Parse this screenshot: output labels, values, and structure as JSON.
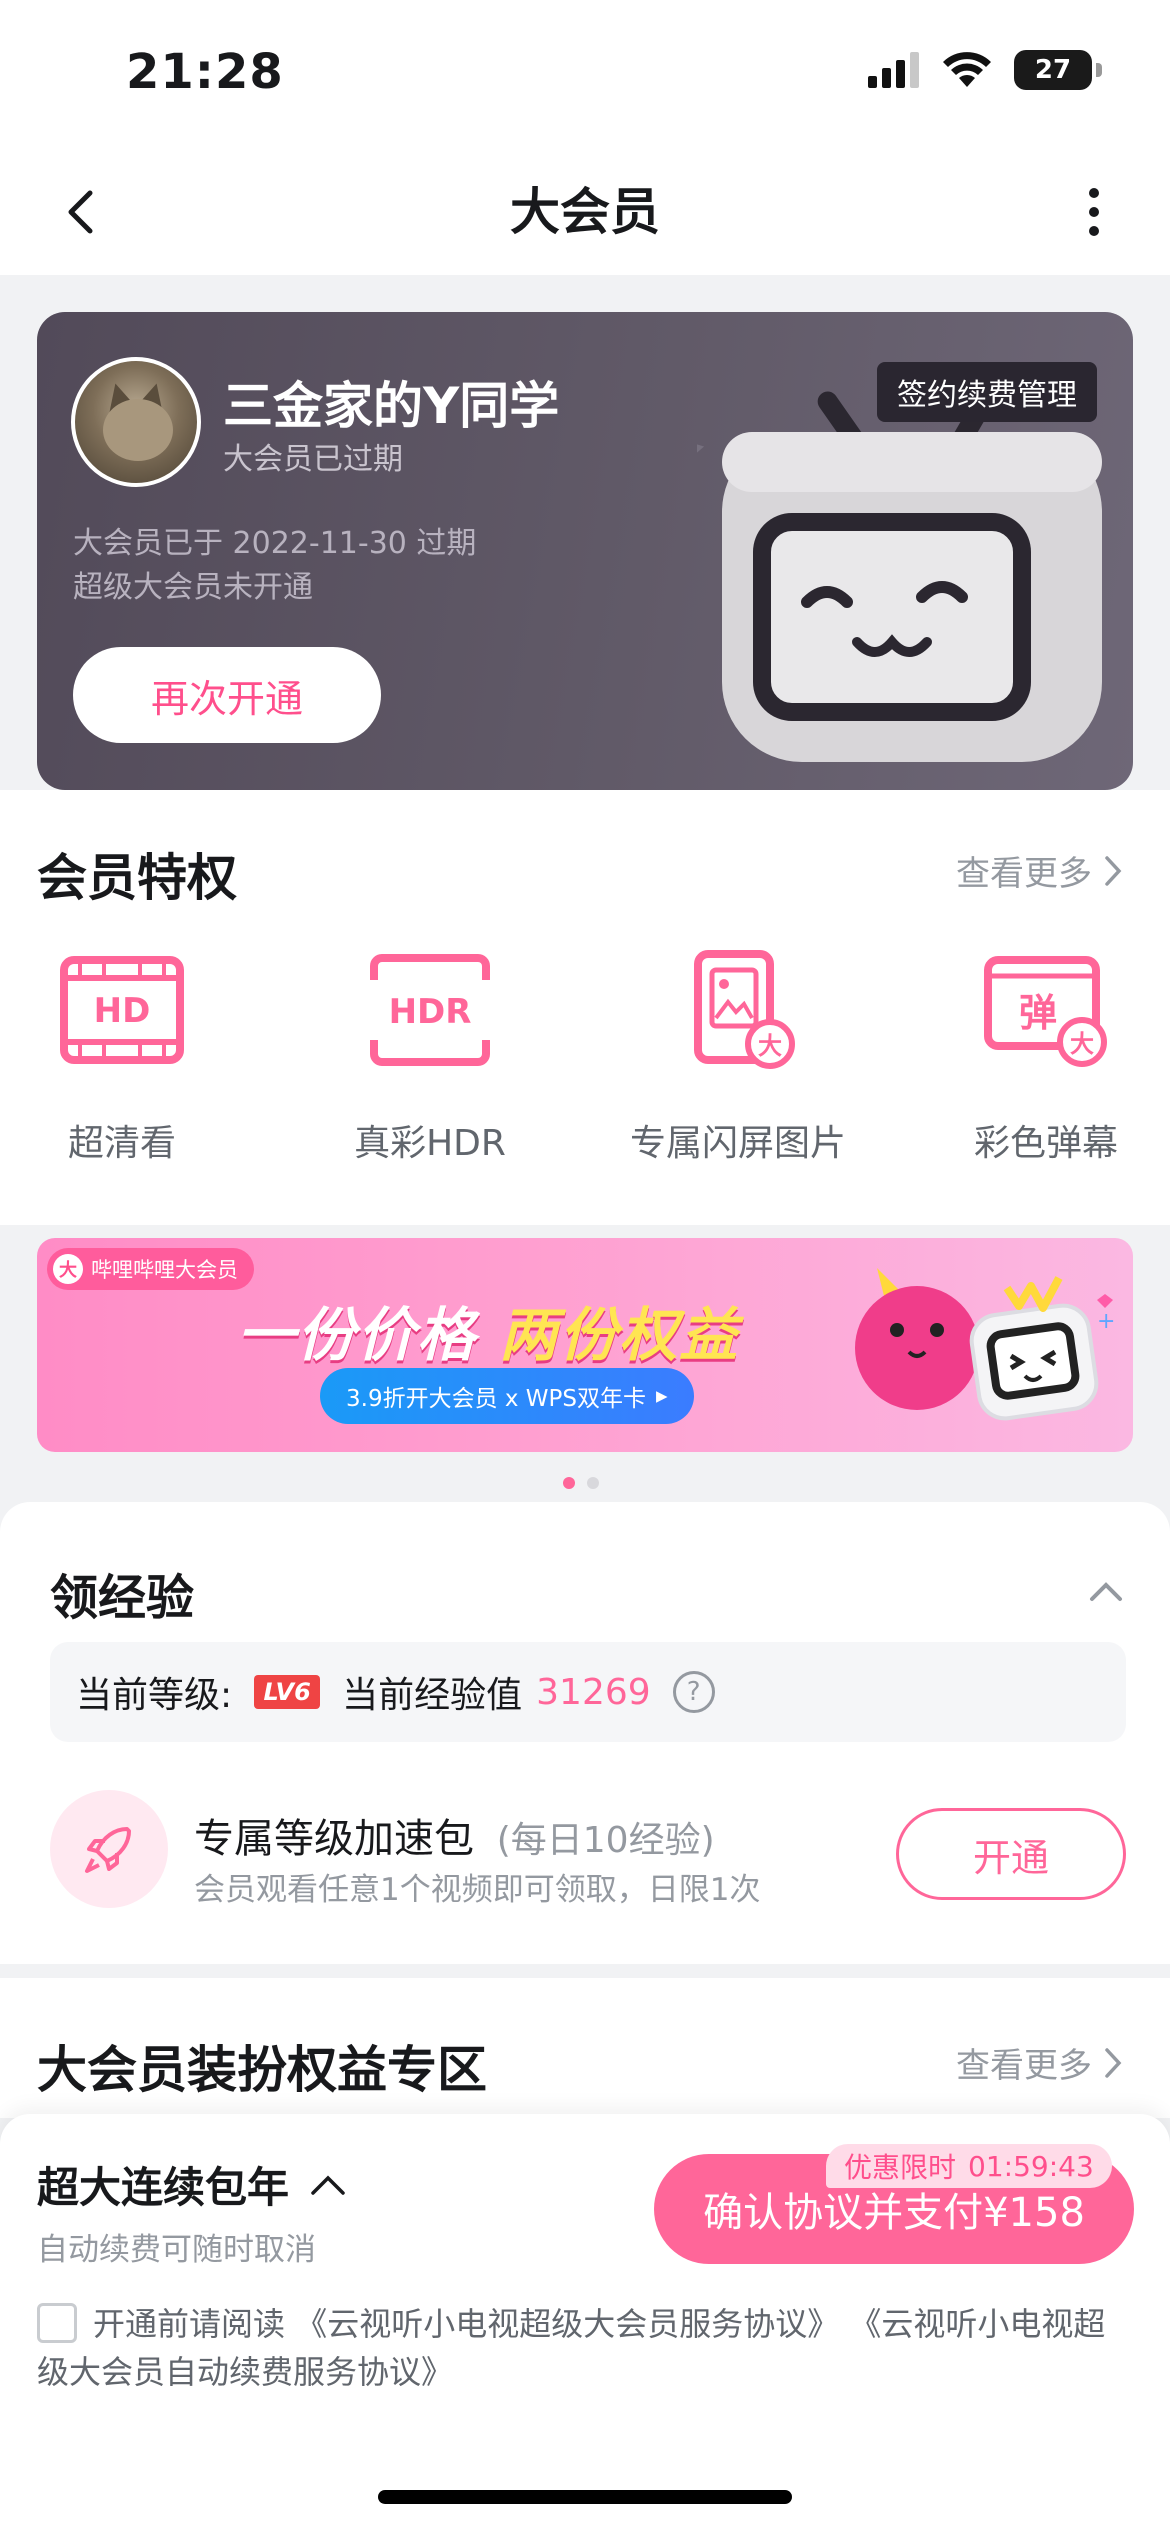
{
  "status_bar": {
    "time": "21:28",
    "battery": "27"
  },
  "nav": {
    "title": "大会员"
  },
  "vip_card": {
    "username": "三金家的Y同学",
    "vip_state": "大会员已过期",
    "expire_line1": "大会员已于 2022-11-30 过期",
    "expire_line2": "超级大会员未开通",
    "renew_label": "再次开通",
    "contract_label": "签约续费管理"
  },
  "privileges": {
    "title": "会员特权",
    "see_more": "查看更多",
    "items": [
      {
        "label": "超清看",
        "icon": "hd-icon"
      },
      {
        "label": "真彩HDR",
        "icon": "hdr-icon"
      },
      {
        "label": "专属闪屏图片",
        "icon": "splash-screen-icon"
      },
      {
        "label": "彩色弹幕",
        "icon": "color-danmaku-icon"
      }
    ]
  },
  "banner": {
    "tag_big": "大",
    "tag": "哔哩哔哩大会员",
    "headline_a": "一份价格",
    "headline_b": "两份权益",
    "pill": "3.9折开大会员 x WPS双年卡",
    "pill_arrow": "▸",
    "active_index": 0,
    "count": 2
  },
  "experience": {
    "title": "领经验",
    "level_label": "当前等级:",
    "level_badge": "LV6",
    "exp_label": "当前经验值",
    "exp_value": "31269",
    "help": "?",
    "boost_title": "专属等级加速包",
    "boost_sub": "(每日10经验)",
    "boost_desc": "会员观看任意1个视频即可领取，日限1次",
    "open_label": "开通"
  },
  "dress_zone": {
    "title": "大会员装扮权益专区",
    "see_more": "查看更多"
  },
  "pay": {
    "plan_name": "超大连续包年",
    "plan_note": "自动续费可随时取消",
    "pay_label": "确认协议并支付¥158",
    "promo_label": "优惠限时",
    "promo_timer": "01:59:43",
    "agree_prefix": "开通前请阅读",
    "agreement1": "《云视听小电视超级大会员服务协议》",
    "agreement2": "《云视听小电视超级大会员自动续费服务协议》"
  },
  "colors": {
    "accent": "#ff6699",
    "card_bg": "#5a5361"
  }
}
